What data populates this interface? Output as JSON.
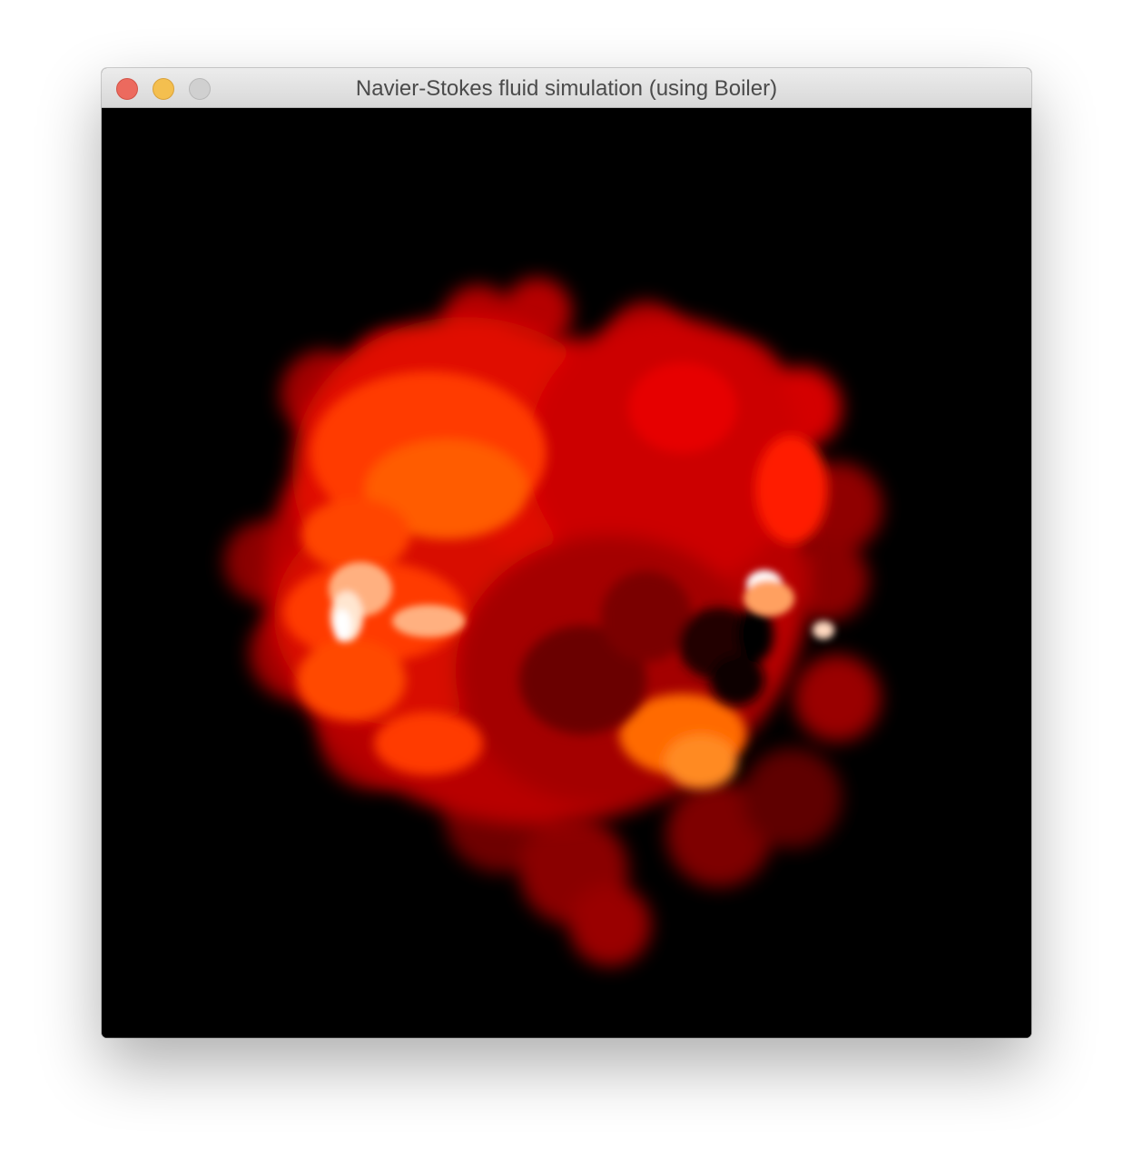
{
  "window": {
    "title": "Navier-Stokes fluid simulation (using Boiler)",
    "controls": {
      "close": {
        "icon": "close-icon",
        "color": "#ec6a5e"
      },
      "minimize": {
        "icon": "minimize-icon",
        "color": "#f4bf4f"
      },
      "zoom": {
        "icon": "zoom-icon",
        "color": "#d0d0d0"
      }
    }
  },
  "simulation": {
    "background_color": "#000000",
    "palette": [
      "#5e0000",
      "#9e0000",
      "#d80000",
      "#ff1a00",
      "#ff4a00",
      "#ff7a1a",
      "#ffd2b0",
      "#ffffff"
    ]
  }
}
